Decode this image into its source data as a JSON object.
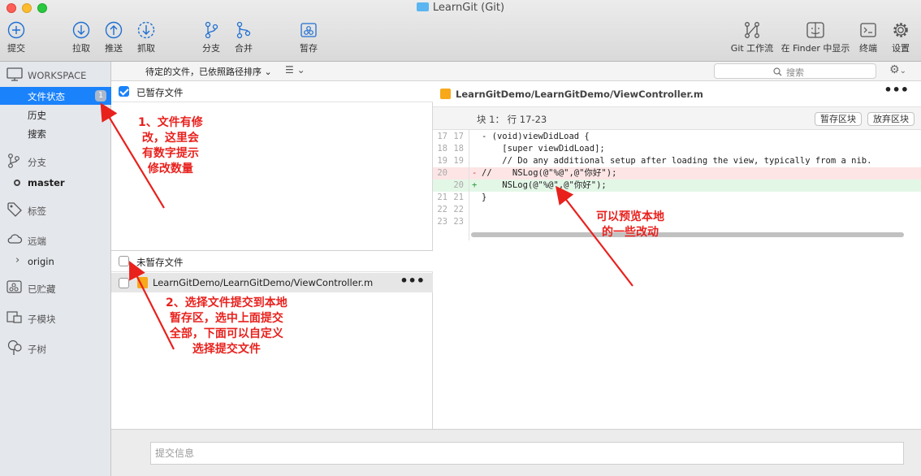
{
  "window": {
    "title": "LearnGit (Git)"
  },
  "toolbar": {
    "commit": "提交",
    "pull": "拉取",
    "push": "推送",
    "fetch": "抓取",
    "branch": "分支",
    "merge": "合并",
    "stash": "暂存",
    "git_flow": "Git 工作流",
    "show_in_finder": "在 Finder 中显示",
    "terminal": "终端",
    "settings": "设置"
  },
  "filebar": {
    "sort": "待定的文件，已依照路径排序",
    "search_placeholder": "搜索"
  },
  "sidebar": {
    "workspace": "WORKSPACE",
    "file_status": "文件状态",
    "file_status_count": "1",
    "history": "历史",
    "search": "搜索",
    "branches": "分支",
    "master": "master",
    "tags": "标签",
    "remotes": "远端",
    "origin": "origin",
    "stashes": "已贮藏",
    "submodules": "子模块",
    "subtrees": "子树"
  },
  "staged": {
    "label": "已暂存文件"
  },
  "unstaged": {
    "label": "未暂存文件",
    "files": [
      {
        "path": "LearnGitDemo/LearnGitDemo/ViewController.m"
      }
    ]
  },
  "diff": {
    "file": "LearnGitDemo/LearnGitDemo/ViewController.m",
    "hunk_label": "块 1： 行 17-23",
    "stage_hunk": "暂存区块",
    "discard_hunk": "放弃区块",
    "lines": [
      {
        "old": "17",
        "new": "17",
        "sign": "",
        "type": "ctx",
        "text": "- (void)viewDidLoad {"
      },
      {
        "old": "18",
        "new": "18",
        "sign": "",
        "type": "ctx",
        "text": "    [super viewDidLoad];"
      },
      {
        "old": "19",
        "new": "19",
        "sign": "",
        "type": "ctx",
        "text": "    // Do any additional setup after loading the view, typically from a nib."
      },
      {
        "old": "20",
        "new": "",
        "sign": "-",
        "type": "del",
        "text": "//    NSLog(@\"%@\",@\"你好\");"
      },
      {
        "old": "",
        "new": "20",
        "sign": "+",
        "type": "add",
        "text": "    NSLog(@\"%@\",@\"你好\");"
      },
      {
        "old": "21",
        "new": "21",
        "sign": "",
        "type": "ctx",
        "text": "}"
      },
      {
        "old": "22",
        "new": "22",
        "sign": "",
        "type": "ctx",
        "text": ""
      },
      {
        "old": "23",
        "new": "23",
        "sign": "",
        "type": "ctx",
        "text": ""
      }
    ]
  },
  "commit": {
    "placeholder": "提交信息"
  },
  "annotations": {
    "a1": "1、文件有修\n改，这里会\n有数字提示\n修改数量",
    "a2": "可以预览本地\n的一些改动",
    "a3": "2、选择文件提交到本地\n暂存区，选中上面提交\n全部，下面可以自定义\n选择提交文件"
  },
  "colors": {
    "accent": "#1a82fb",
    "annotation": "#e8211d",
    "deleted_bg": "#fde5e5",
    "added_bg": "#e3f7e7"
  }
}
